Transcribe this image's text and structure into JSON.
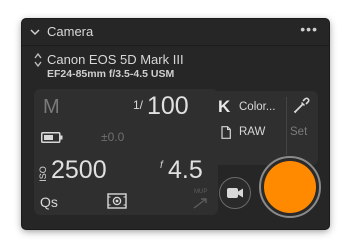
{
  "panel": {
    "title": "Camera",
    "more_label": "•••"
  },
  "camera": {
    "name": "Canon EOS 5D Mark III",
    "lens": "EF24-85mm f/3.5-4.5 USM"
  },
  "exposure": {
    "mode": "M",
    "shutter_prefix": "1/",
    "shutter": "100",
    "exposure_comp": "±0.0",
    "iso_label": "ISO",
    "iso": "2500",
    "aperture_prefix": "f",
    "aperture": "4.5",
    "drive": "Qs",
    "mirror_lockup_label": "MUP"
  },
  "capture_settings": {
    "wb_icon": "K",
    "white_balance": "Color...",
    "format": "RAW",
    "set_label": "Set"
  },
  "colors": {
    "accent": "#ff8a00",
    "panel_bg": "#262626",
    "box_bg": "#2f2f2f"
  },
  "icons": [
    "chevron-down-icon",
    "more-icon",
    "updown-chevron-icon",
    "battery-icon",
    "metering-icon",
    "mirror-lockup-icon",
    "eyedropper-icon",
    "document-icon",
    "video-camera-icon"
  ]
}
